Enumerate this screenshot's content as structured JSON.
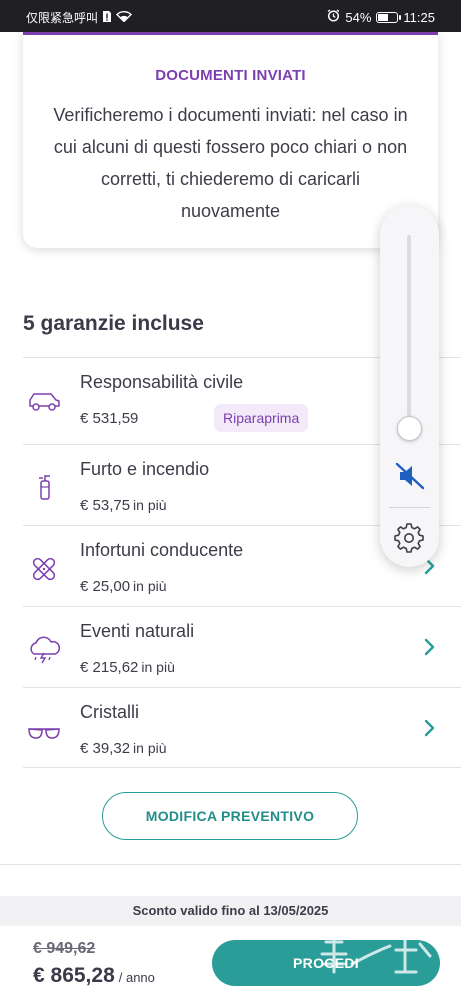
{
  "status_bar": {
    "carrier_text": "仅限紧急呼叫",
    "battery_percent": "54%",
    "time": "11:25",
    "battery_level": 0.54
  },
  "documents_card": {
    "title": "DOCUMENTI INVIATI",
    "body": "Verificheremo i documenti inviati: nel caso in cui alcuni di questi fossero poco chiari o non corretti, ti chiederemo di caricarli nuovamente"
  },
  "coverages": {
    "title": "5 garanzie incluse",
    "items": [
      {
        "name": "Responsabilità civile",
        "price": "€ 531,59",
        "suffix": "",
        "badge": "Riparaprima",
        "icon": "car-icon"
      },
      {
        "name": "Furto e incendio",
        "price": "€ 53,75",
        "suffix": "in più",
        "badge": "",
        "icon": "fire-extinguisher-icon"
      },
      {
        "name": "Infortuni conducente",
        "price": "€ 25,00",
        "suffix": "in più",
        "badge": "",
        "icon": "bandage-icon"
      },
      {
        "name": "Eventi naturali",
        "price": "€ 215,62",
        "suffix": "in più",
        "badge": "",
        "icon": "storm-cloud-icon"
      },
      {
        "name": "Cristalli",
        "price": "€ 39,32",
        "suffix": "in più",
        "badge": "",
        "icon": "glasses-icon"
      }
    ]
  },
  "actions": {
    "modify_label": "MODIFICA PREVENTIVO",
    "proceed_label": "PROCEDI"
  },
  "discount": {
    "text": "Sconto valido fino al 13/05/2025"
  },
  "pricing": {
    "old_price": "€ 949,62",
    "new_price": "€ 865,28",
    "period": "/ anno"
  },
  "watermark": {
    "text": "HUARENJIE"
  },
  "volume_panel": {
    "level": 0.06,
    "muted": true
  },
  "colors": {
    "accent_purple": "#7b3fb0",
    "accent_teal": "#2a9d99"
  }
}
